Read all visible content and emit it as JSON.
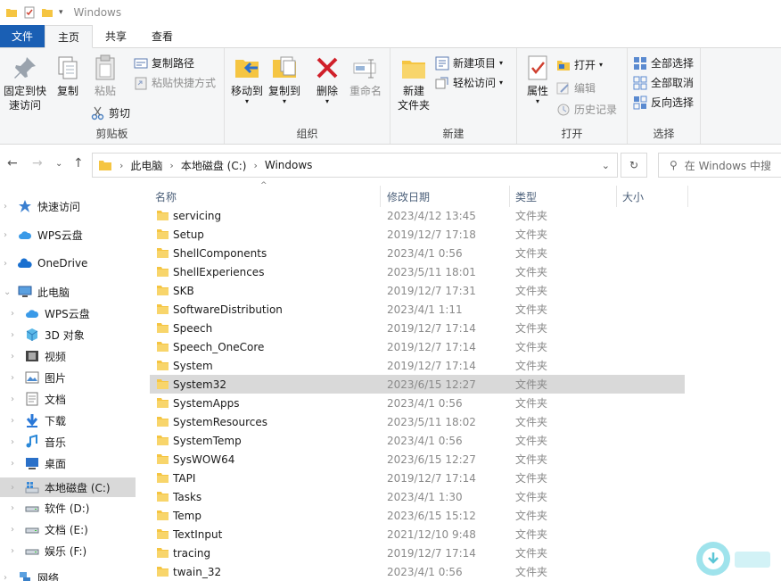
{
  "window": {
    "title": "Windows"
  },
  "tabs": [
    {
      "label": "文件"
    },
    {
      "label": "主页"
    },
    {
      "label": "共享"
    },
    {
      "label": "查看"
    }
  ],
  "ribbon": {
    "clipboard": {
      "label": "剪贴板",
      "pin": "固定到快\n速访问",
      "copy": "复制",
      "paste": "粘贴",
      "copy_path": "复制路径",
      "paste_shortcut": "粘贴快捷方式",
      "cut": "剪切"
    },
    "organize": {
      "label": "组织",
      "move_to": "移动到",
      "copy_to": "复制到",
      "delete": "删除",
      "rename": "重命名"
    },
    "new": {
      "label": "新建",
      "new_folder": "新建\n文件夹",
      "new_item": "新建项目",
      "easy_access": "轻松访问"
    },
    "open": {
      "label": "打开",
      "properties": "属性",
      "open": "打开",
      "edit": "编辑",
      "history": "历史记录"
    },
    "select": {
      "label": "选择",
      "select_all": "全部选择",
      "select_none": "全部取消",
      "invert": "反向选择"
    }
  },
  "address": {
    "crumbs": [
      "此电脑",
      "本地磁盘 (C:)",
      "Windows"
    ],
    "search_placeholder": "在 Windows 中搜"
  },
  "nav": [
    {
      "label": "快速访问",
      "icon": "star-icon",
      "level": 0
    },
    {
      "label": "WPS云盘",
      "icon": "cloud-icon",
      "level": 0
    },
    {
      "label": "OneDrive",
      "icon": "onedrive-icon",
      "level": 0
    },
    {
      "label": "此电脑",
      "icon": "computer-icon",
      "level": 0
    },
    {
      "label": "WPS云盘",
      "icon": "cloud-icon",
      "level": 1
    },
    {
      "label": "3D 对象",
      "icon": "cube-icon",
      "level": 1
    },
    {
      "label": "视频",
      "icon": "video-icon",
      "level": 1
    },
    {
      "label": "图片",
      "icon": "picture-icon",
      "level": 1
    },
    {
      "label": "文档",
      "icon": "document-icon",
      "level": 1
    },
    {
      "label": "下载",
      "icon": "download-icon",
      "level": 1
    },
    {
      "label": "音乐",
      "icon": "music-icon",
      "level": 1
    },
    {
      "label": "桌面",
      "icon": "desktop-icon",
      "level": 1
    },
    {
      "label": "本地磁盘 (C:)",
      "icon": "drive-c-icon",
      "level": 1,
      "selected": true
    },
    {
      "label": "软件 (D:)",
      "icon": "drive-icon",
      "level": 1
    },
    {
      "label": "文档 (E:)",
      "icon": "drive-icon",
      "level": 1
    },
    {
      "label": "娱乐 (F:)",
      "icon": "drive-icon",
      "level": 1
    },
    {
      "label": "网络",
      "icon": "network-icon",
      "level": 0
    }
  ],
  "columns": {
    "name": "名称",
    "date": "修改日期",
    "type": "类型",
    "size": "大小"
  },
  "files": [
    {
      "name": "servicing",
      "date": "2023/4/12 13:45",
      "type": "文件夹"
    },
    {
      "name": "Setup",
      "date": "2019/12/7 17:18",
      "type": "文件夹"
    },
    {
      "name": "ShellComponents",
      "date": "2023/4/1 0:56",
      "type": "文件夹"
    },
    {
      "name": "ShellExperiences",
      "date": "2023/5/11 18:01",
      "type": "文件夹"
    },
    {
      "name": "SKB",
      "date": "2019/12/7 17:31",
      "type": "文件夹"
    },
    {
      "name": "SoftwareDistribution",
      "date": "2023/4/1 1:11",
      "type": "文件夹"
    },
    {
      "name": "Speech",
      "date": "2019/12/7 17:14",
      "type": "文件夹"
    },
    {
      "name": "Speech_OneCore",
      "date": "2019/12/7 17:14",
      "type": "文件夹"
    },
    {
      "name": "System",
      "date": "2019/12/7 17:14",
      "type": "文件夹"
    },
    {
      "name": "System32",
      "date": "2023/6/15 12:27",
      "type": "文件夹",
      "selected": true
    },
    {
      "name": "SystemApps",
      "date": "2023/4/1 0:56",
      "type": "文件夹"
    },
    {
      "name": "SystemResources",
      "date": "2023/5/11 18:02",
      "type": "文件夹"
    },
    {
      "name": "SystemTemp",
      "date": "2023/4/1 0:56",
      "type": "文件夹"
    },
    {
      "name": "SysWOW64",
      "date": "2023/6/15 12:27",
      "type": "文件夹"
    },
    {
      "name": "TAPI",
      "date": "2019/12/7 17:14",
      "type": "文件夹"
    },
    {
      "name": "Tasks",
      "date": "2023/4/1 1:30",
      "type": "文件夹"
    },
    {
      "name": "Temp",
      "date": "2023/6/15 15:12",
      "type": "文件夹"
    },
    {
      "name": "TextInput",
      "date": "2021/12/10 9:48",
      "type": "文件夹"
    },
    {
      "name": "tracing",
      "date": "2019/12/7 17:14",
      "type": "文件夹"
    },
    {
      "name": "twain_32",
      "date": "2023/4/1 0:56",
      "type": "文件夹"
    }
  ],
  "colors": {
    "accent": "#1a5fb4",
    "folder": "#f5c542",
    "selection": "#d9d9d9"
  }
}
